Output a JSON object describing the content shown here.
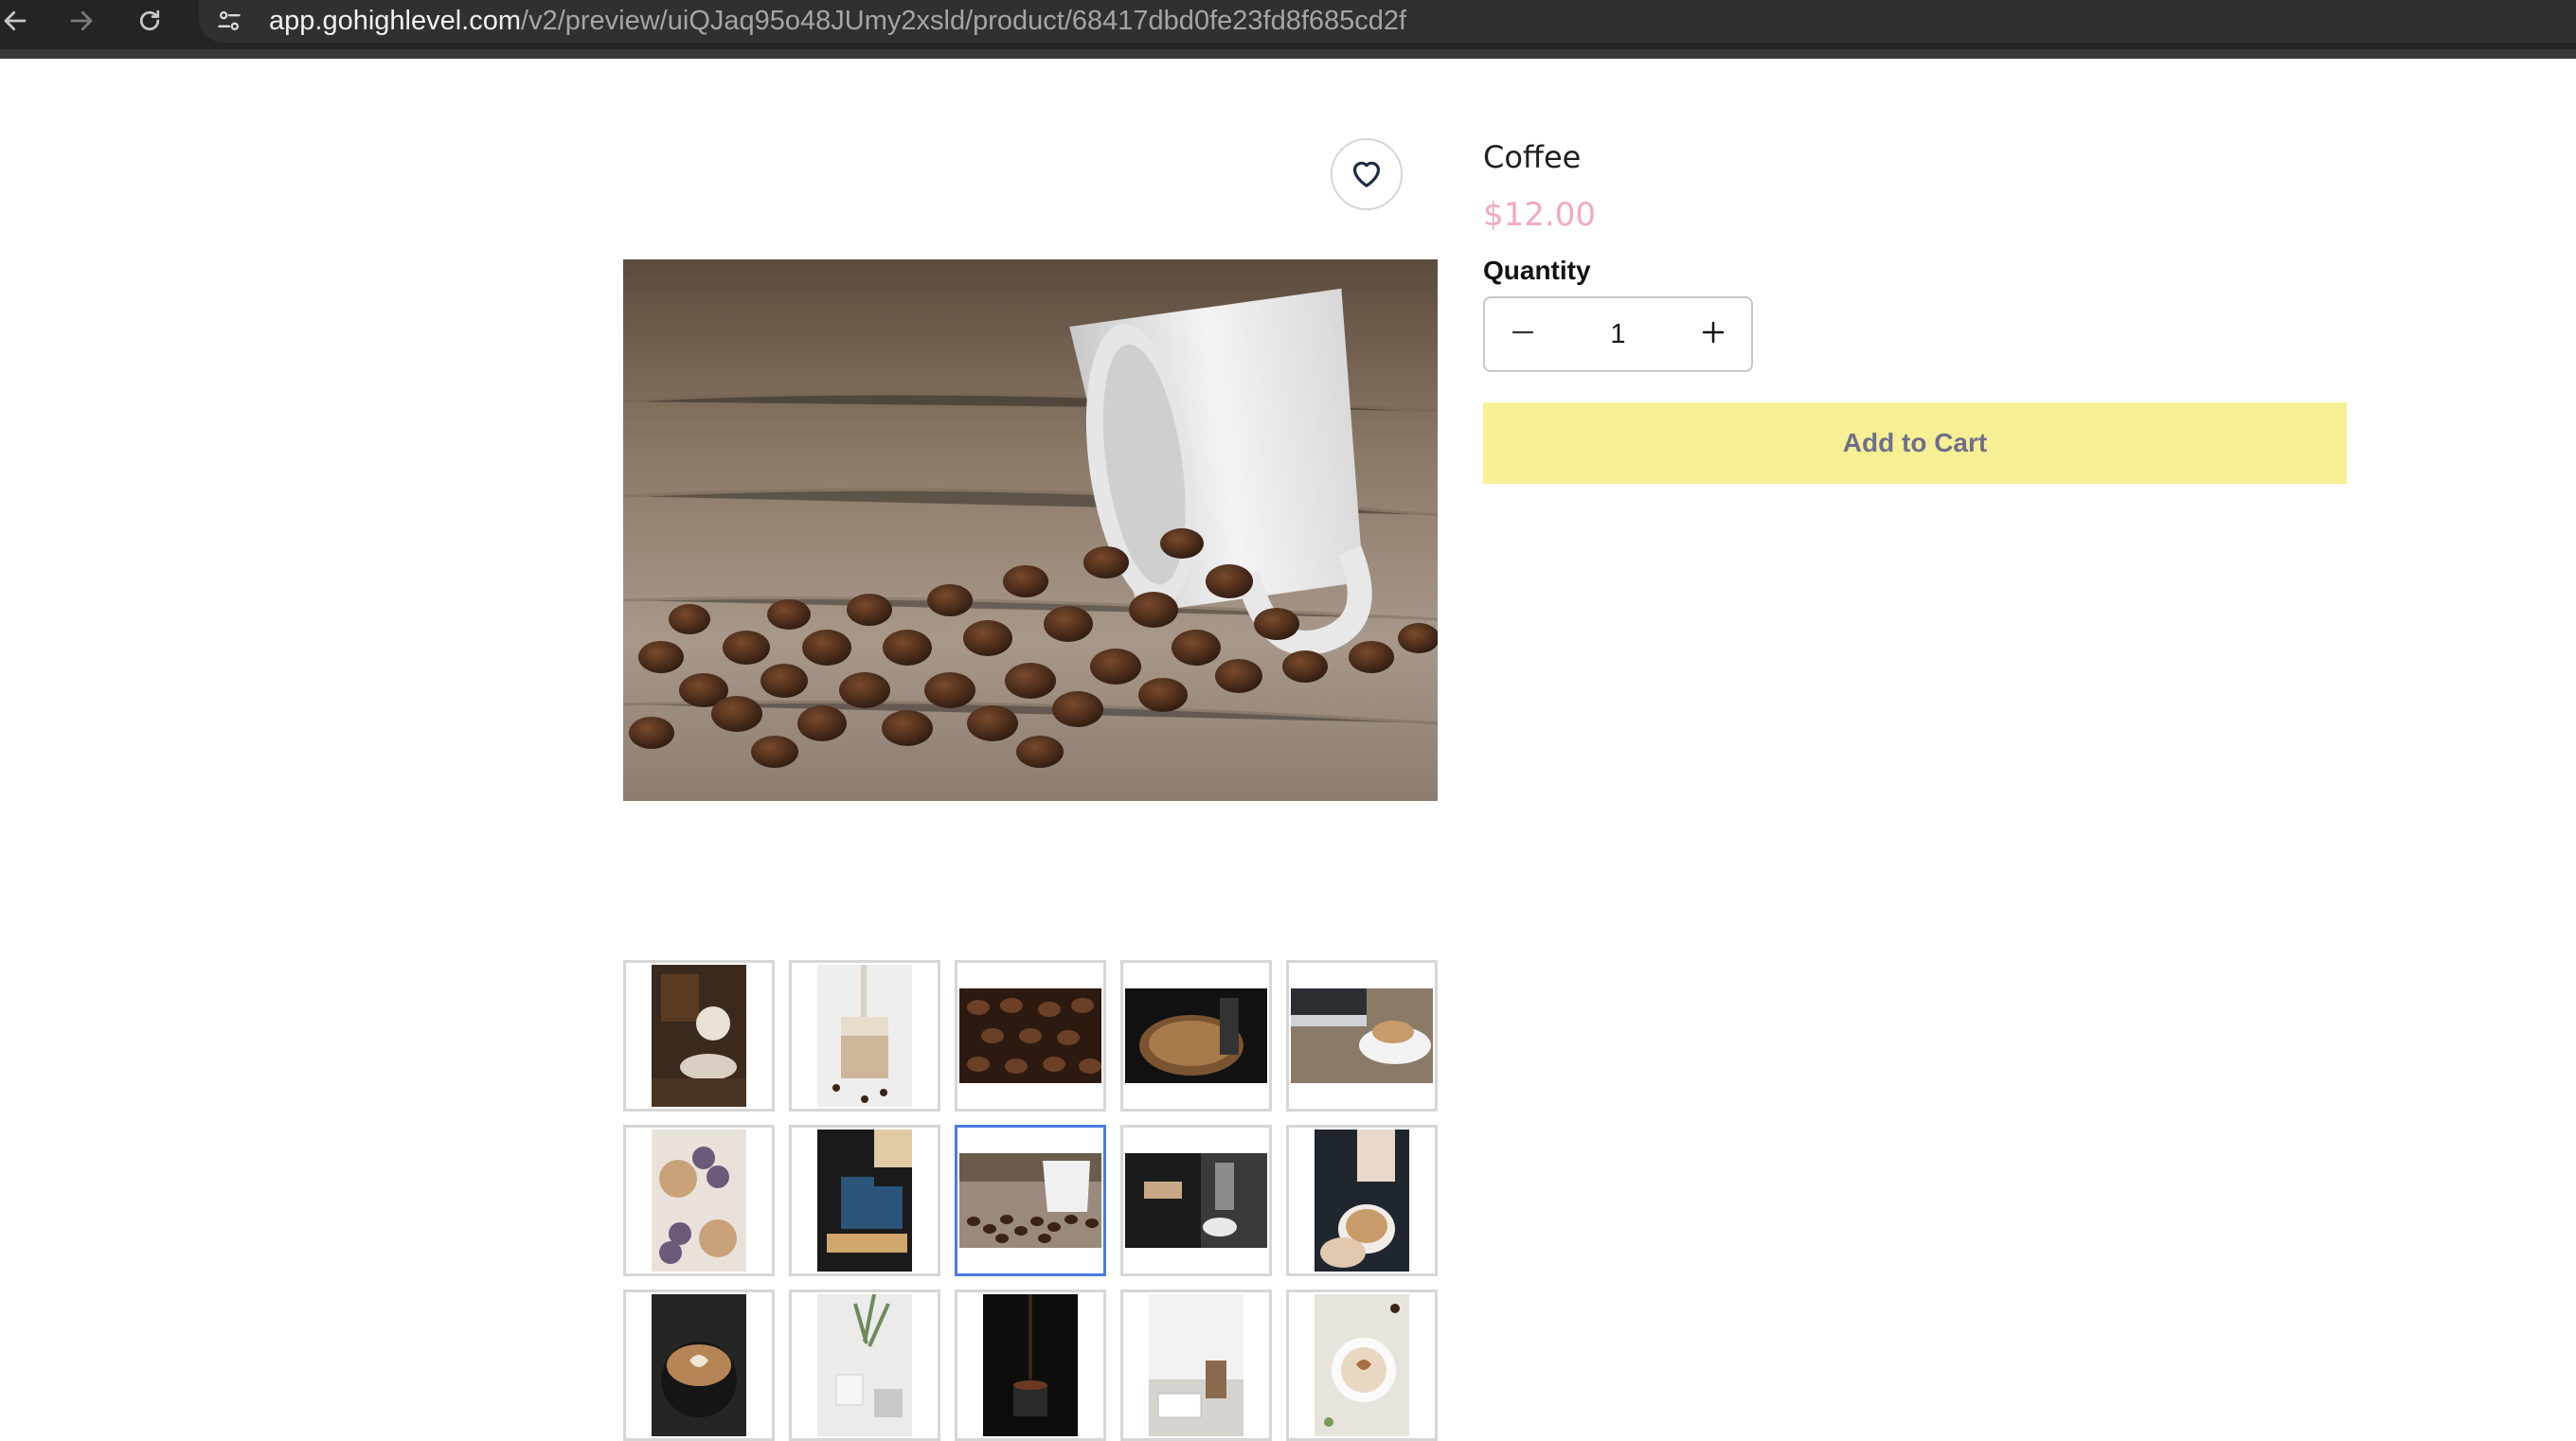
{
  "browser": {
    "url_host": "app.gohighlevel.com",
    "url_path": "/v2/preview/uiQJaq95o48JUmy2xsld/product/68417dbd0fe23fd8f685cd2f",
    "back_icon": "arrow-left-icon",
    "forward_icon": "arrow-right-icon",
    "reload_icon": "reload-icon",
    "site_info_icon": "tune-icon"
  },
  "product": {
    "name": "Coffee",
    "price": "$12.00",
    "quantity_label": "Quantity",
    "quantity": "1",
    "add_to_cart_label": "Add to Cart",
    "wishlist_icon": "heart-icon",
    "decrement_icon": "minus-icon",
    "increment_icon": "plus-icon"
  },
  "gallery": {
    "selected_index": 7,
    "thumbnail_count": 15
  },
  "colors": {
    "price": "#f2a9bd",
    "add_to_cart_bg": "#f7ef94",
    "add_to_cart_text": "#6f6f8a",
    "thumb_selected_border": "#4a7be0"
  }
}
